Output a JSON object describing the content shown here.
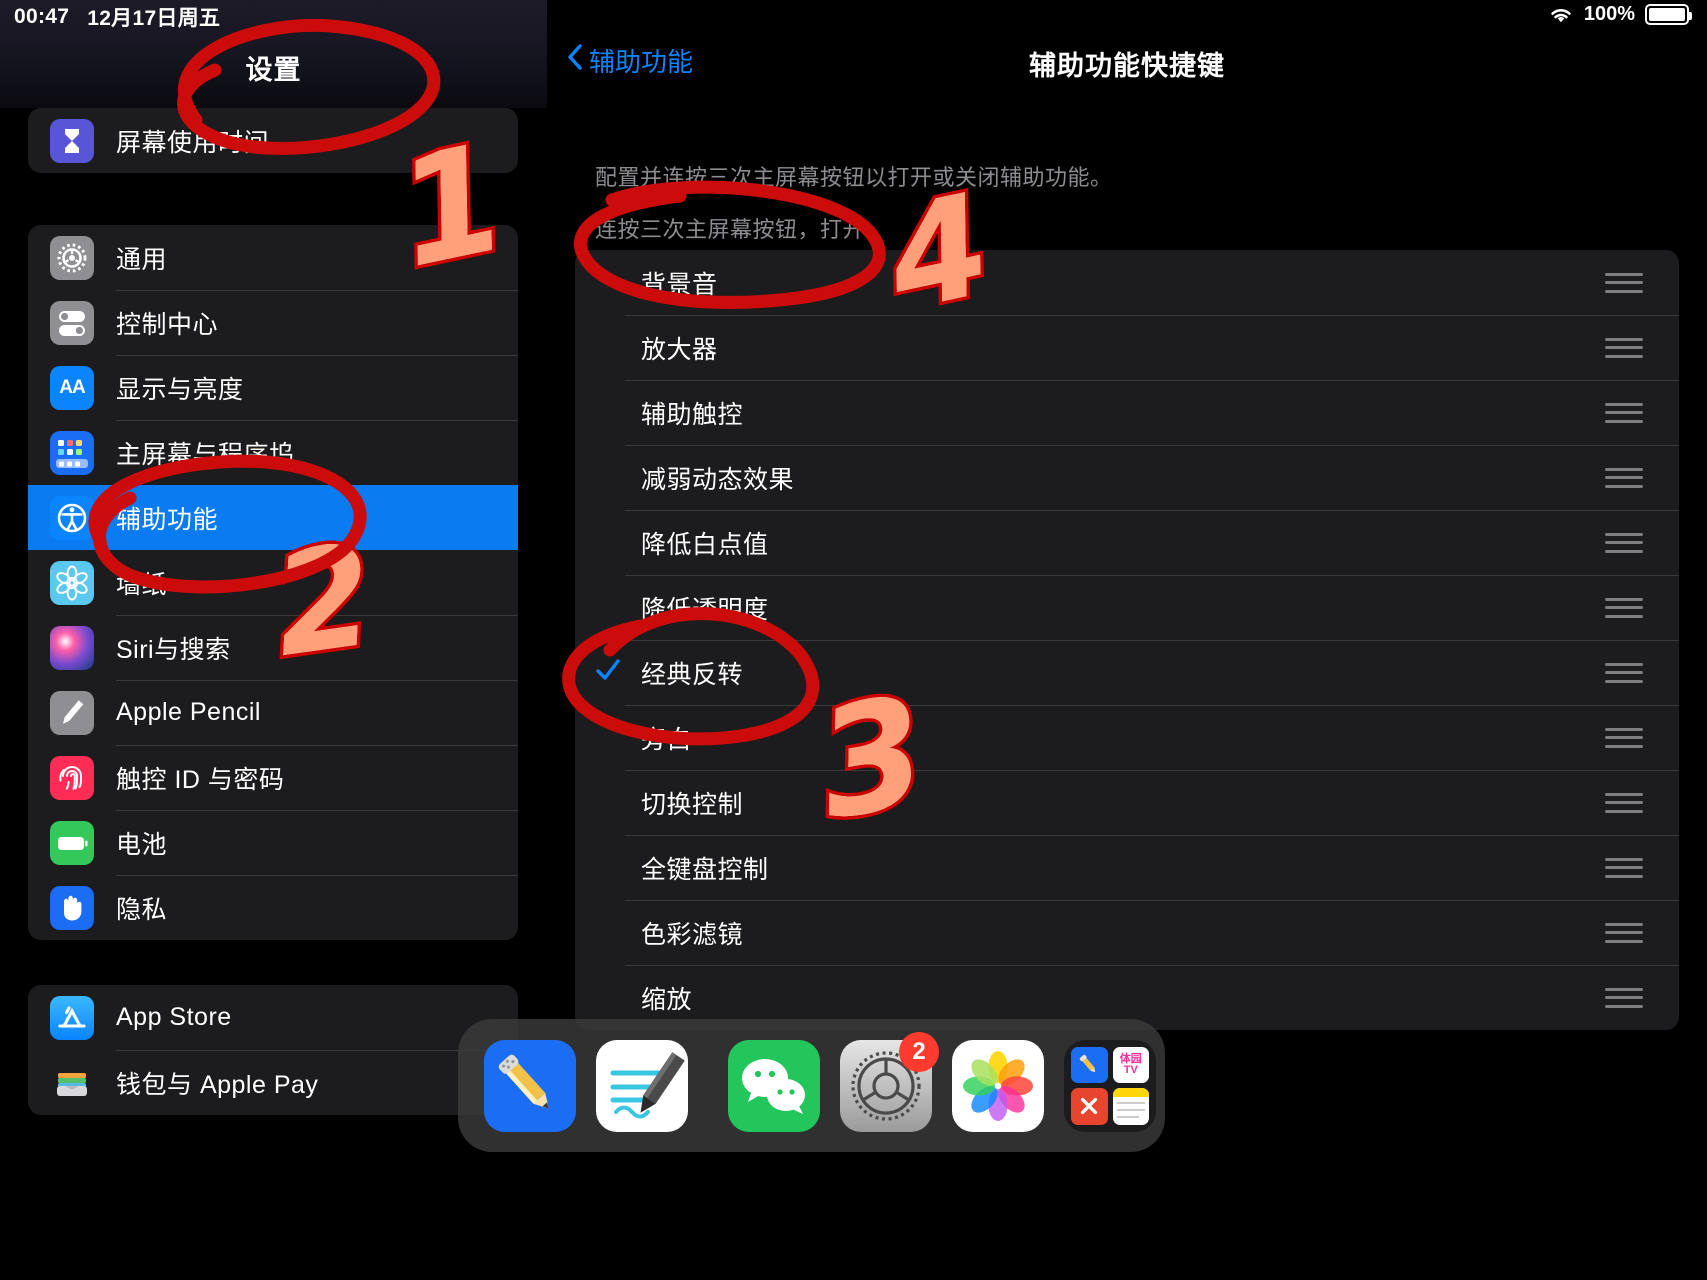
{
  "status_bar": {
    "time": "00:47",
    "date": "12月17日周五",
    "wifi_icon": "wifi-icon",
    "battery_percent": "100%",
    "battery_icon": "battery-full-icon"
  },
  "sidebar": {
    "title": "设置",
    "groups": [
      {
        "items": [
          {
            "label": "屏幕使用时间",
            "icon": "hourglass-icon",
            "icon_class": "ico-screentime",
            "selected": false
          }
        ]
      },
      {
        "items": [
          {
            "label": "通用",
            "icon": "gear-icon",
            "icon_class": "ico-general",
            "selected": false
          },
          {
            "label": "控制中心",
            "icon": "toggles-icon",
            "icon_class": "ico-control",
            "selected": false
          },
          {
            "label": "显示与亮度",
            "icon": "aa-text-icon",
            "icon_class": "ico-display",
            "selected": false
          },
          {
            "label": "主屏幕与程序坞",
            "icon": "home-grid-icon",
            "icon_class": "ico-home",
            "selected": false
          },
          {
            "label": "辅助功能",
            "icon": "accessibility-icon",
            "icon_class": "ico-access",
            "selected": true
          },
          {
            "label": "墙纸",
            "icon": "flower-icon",
            "icon_class": "ico-wallpaper",
            "selected": false
          },
          {
            "label": "Siri与搜索",
            "icon": "siri-orb-icon",
            "icon_class": "ico-siri",
            "selected": false
          },
          {
            "label": "Apple Pencil",
            "icon": "pencil-icon",
            "icon_class": "ico-pencil",
            "selected": false
          },
          {
            "label": "触控 ID 与密码",
            "icon": "fingerprint-icon",
            "icon_class": "ico-touchid",
            "selected": false
          },
          {
            "label": "电池",
            "icon": "battery-icon",
            "icon_class": "ico-battery",
            "selected": false
          },
          {
            "label": "隐私",
            "icon": "hand-icon",
            "icon_class": "ico-privacy",
            "selected": false
          }
        ]
      },
      {
        "items": [
          {
            "label": "App Store",
            "icon": "app-store-icon",
            "icon_class": "ico-appstore",
            "selected": false
          },
          {
            "label": "钱包与 Apple Pay",
            "icon": "wallet-icon",
            "icon_class": "ico-wallet",
            "selected": false
          }
        ]
      }
    ]
  },
  "detail": {
    "back_label": "辅助功能",
    "back_icon": "chevron-left-icon",
    "title": "辅助功能快捷键",
    "description_line1": "配置并连按三次主屏幕按钮以打开或关闭辅助功能。",
    "description_line2": "连按三次主屏幕按钮，打开:",
    "handle_icon": "drag-handle-icon",
    "check_icon": "checkmark-icon",
    "options": [
      {
        "label": "背景音",
        "checked": false
      },
      {
        "label": "放大器",
        "checked": false
      },
      {
        "label": "辅助触控",
        "checked": false
      },
      {
        "label": "减弱动态效果",
        "checked": false
      },
      {
        "label": "降低白点值",
        "checked": false
      },
      {
        "label": "降低透明度",
        "checked": false
      },
      {
        "label": "经典反转",
        "checked": true
      },
      {
        "label": "旁白",
        "checked": false
      },
      {
        "label": "切换控制",
        "checked": false
      },
      {
        "label": "全键盘控制",
        "checked": false
      },
      {
        "label": "色彩滤镜",
        "checked": false
      },
      {
        "label": "缩放",
        "checked": false
      }
    ]
  },
  "dock": {
    "apps": [
      {
        "name": "notability",
        "badge": ""
      },
      {
        "name": "notes-writer",
        "badge": ""
      },
      {
        "name": "separator",
        "badge": ""
      },
      {
        "name": "wechat",
        "badge": ""
      },
      {
        "name": "settings",
        "badge": "2"
      },
      {
        "name": "photos",
        "badge": ""
      },
      {
        "name": "folder",
        "badge": ""
      }
    ]
  },
  "annotations": {
    "marks": [
      {
        "number": "1",
        "target": "settings-title-circle"
      },
      {
        "number": "2",
        "target": "accessibility-sidebar-circle"
      },
      {
        "number": "3",
        "target": "classic-invert-circle"
      },
      {
        "number": "4",
        "target": "triple-click-text-circle"
      }
    ],
    "stroke_color": "#cc0000",
    "fill_color": "#ffa07a"
  }
}
